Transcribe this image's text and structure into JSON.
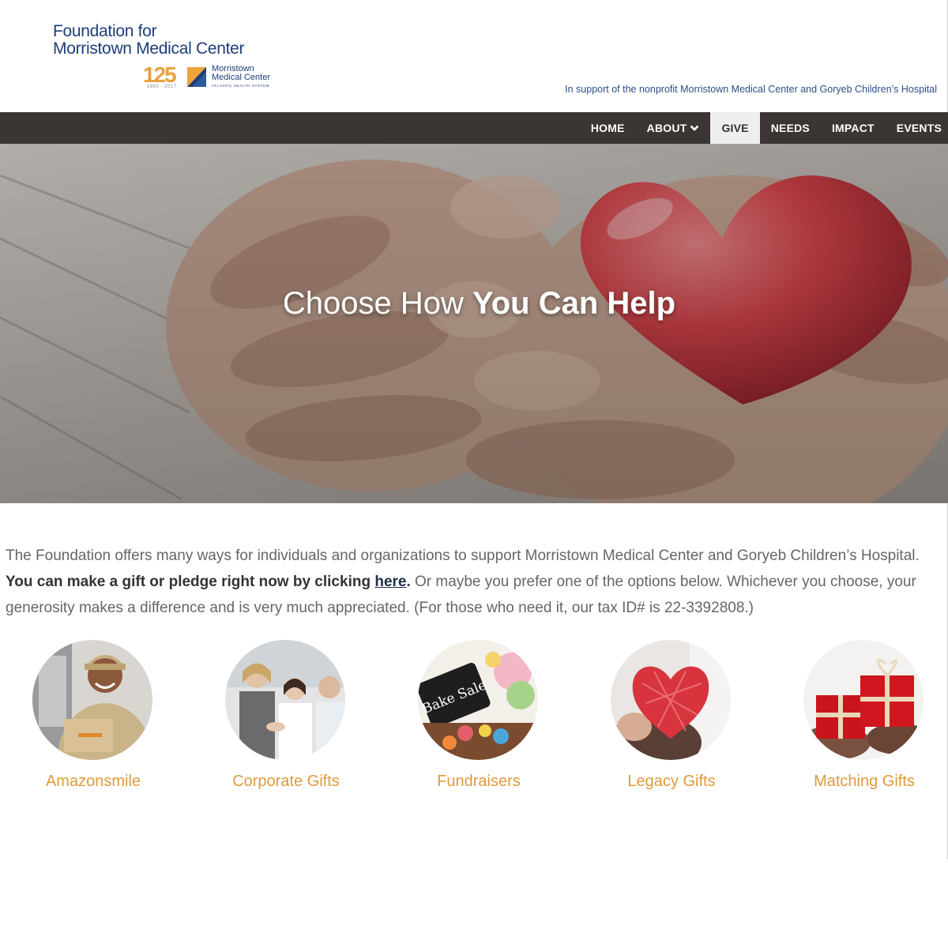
{
  "header": {
    "logo_line1": "Foundation for",
    "logo_line2": "Morristown Medical Center",
    "anniversary_number": "125",
    "anniversary_years": "1892 - 2017",
    "anniversary_org_line1": "Morristown",
    "anniversary_org_line2": "Medical Center",
    "anniversary_system": "ATLANTIC HEALTH SYSTEM",
    "tagline": "In support of the nonprofit Morristown Medical Center and Goryeb Children’s Hospital"
  },
  "nav": {
    "items": [
      {
        "label": "HOME"
      },
      {
        "label": "ABOUT"
      },
      {
        "label": "GIVE"
      },
      {
        "label": "NEEDS"
      },
      {
        "label": "IMPACT"
      },
      {
        "label": "EVENTS"
      }
    ],
    "active": "GIVE"
  },
  "hero": {
    "title_light": "Choose How ",
    "title_bold": "You Can Help"
  },
  "intro": {
    "text1": "The Foundation offers many ways for individuals and organizations to support Morristown Medical Center and Goryeb Children’s Hospital. ",
    "bold_text": "You can make a gift or pledge right now by clicking ",
    "link_text": "here",
    "bold_end": ".",
    "text2": " Or maybe you prefer one of the options below. Whichever you choose, your generosity makes a difference and is very much appreciated. (For those who need it, our tax ID# is 22-3392808.)"
  },
  "options": [
    {
      "label": "Amazonsmile",
      "icon": "delivery-person-photo"
    },
    {
      "label": "Corporate Gifts",
      "icon": "business-handshake-photo"
    },
    {
      "label": "Fundraisers",
      "icon": "bake-sale-photo"
    },
    {
      "label": "Legacy Gifts",
      "icon": "heart-in-hands-photo"
    },
    {
      "label": "Matching Gifts",
      "icon": "gift-boxes-photo"
    }
  ],
  "bake_sale_sign": "Bake Sale",
  "colors": {
    "nav_bg": "#3b3633",
    "logo_blue": "#1f3d7a",
    "accent_orange": "#e09a3c",
    "active_tab_bg": "#eeeeee"
  }
}
